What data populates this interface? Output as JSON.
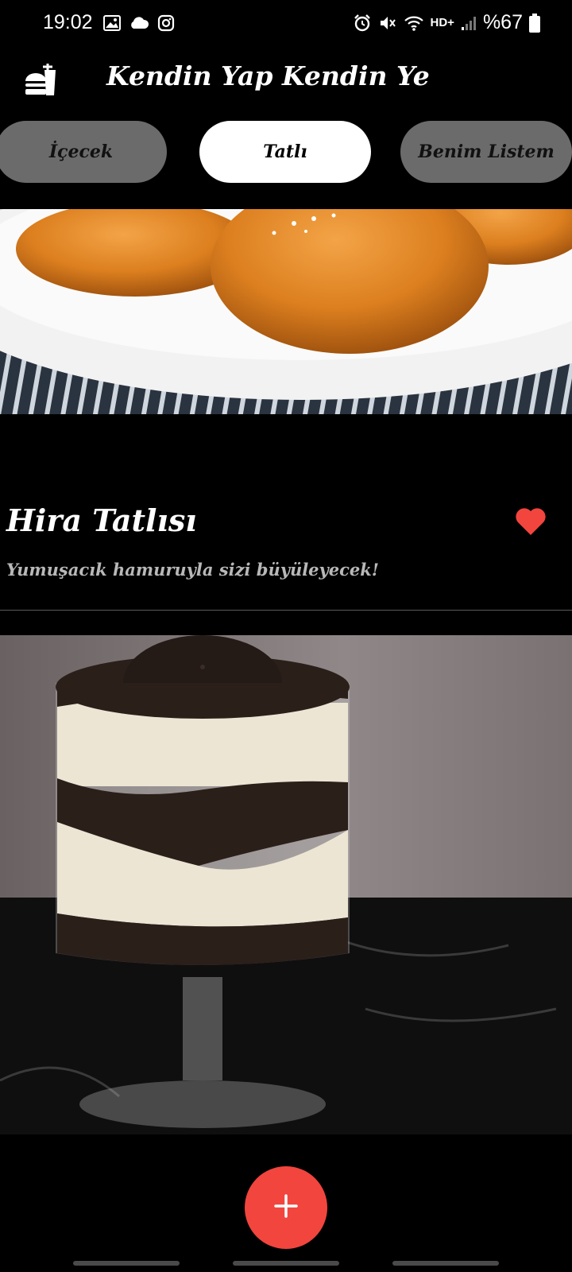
{
  "status_bar": {
    "time": "19:02",
    "network_label": "HD+",
    "battery": "%67",
    "left_icons": [
      "gallery-icon",
      "cloud-icon",
      "instagram-icon"
    ],
    "right_icons": [
      "alarm-icon",
      "mute-icon",
      "wifi-icon",
      "signal-icon",
      "battery-icon"
    ]
  },
  "app_bar": {
    "title": "Kendin Yap Kendin Ye",
    "logo_icon": "fast-food-icon"
  },
  "tabs": [
    {
      "label": "İçecek",
      "active": false
    },
    {
      "label": "Tatlı",
      "active": true
    },
    {
      "label": "Benim Listem",
      "active": false
    }
  ],
  "recipes": [
    {
      "title": "Hira Tatlısı",
      "subtitle": "Yumuşacık hamuruyla sizi büyüleyecek!",
      "favorite": true,
      "image": "sweet-semolina-balls-photo"
    },
    {
      "title": "",
      "subtitle": "",
      "image": "oreo-pudding-cup-photo"
    }
  ],
  "fab": {
    "icon": "plus-icon"
  },
  "colors": {
    "background": "#000000",
    "tab_inactive": "#6b6b6b",
    "tab_active": "#ffffff",
    "accent": "#f2453d",
    "subtitle": "#b8b8b8"
  }
}
